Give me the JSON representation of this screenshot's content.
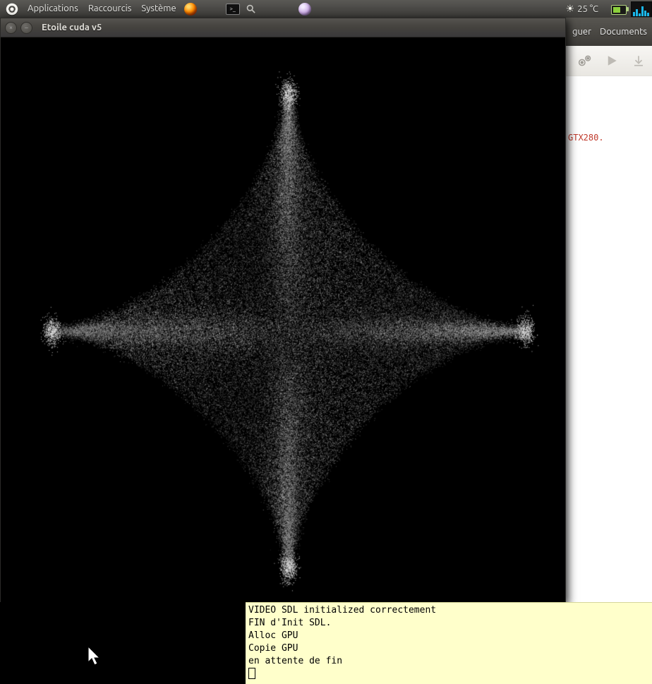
{
  "panel": {
    "menus": [
      "Applications",
      "Raccourcis",
      "Système"
    ],
    "weather": "25 °C"
  },
  "etoile": {
    "title": "Etoile cuda v5"
  },
  "ide": {
    "menu_items": [
      "guer",
      "Documents"
    ],
    "red_text": "GTX280."
  },
  "terminal": {
    "lines": [
      "VIDEO SDL initialized correctement",
      "FIN d'Init SDL.",
      "Alloc GPU",
      "Copie GPU",
      "en attente de fin"
    ]
  }
}
